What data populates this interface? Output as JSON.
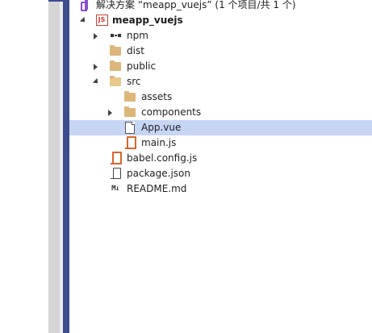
{
  "solution": {
    "label": "解决方案 “meapp_vuejs” (1 个项目/共 1 个)"
  },
  "project": {
    "label": "meapp_vuejs",
    "icon": "js-project-icon"
  },
  "tree": {
    "npm": "npm",
    "dist": "dist",
    "public": "public",
    "src": "src",
    "assets": "assets",
    "components": "components",
    "app_vue": "App.vue",
    "main_js": "main.js",
    "babel_config": "babel.config.js",
    "package_json": "package.json",
    "readme": "README.md"
  },
  "colors": {
    "selection": "#c7d5f5",
    "folder": "#dcb67a",
    "js_accent": "#d9652a",
    "solution_purple": "#8a4fc6",
    "sidebar_blue": "#3c4c8c"
  }
}
